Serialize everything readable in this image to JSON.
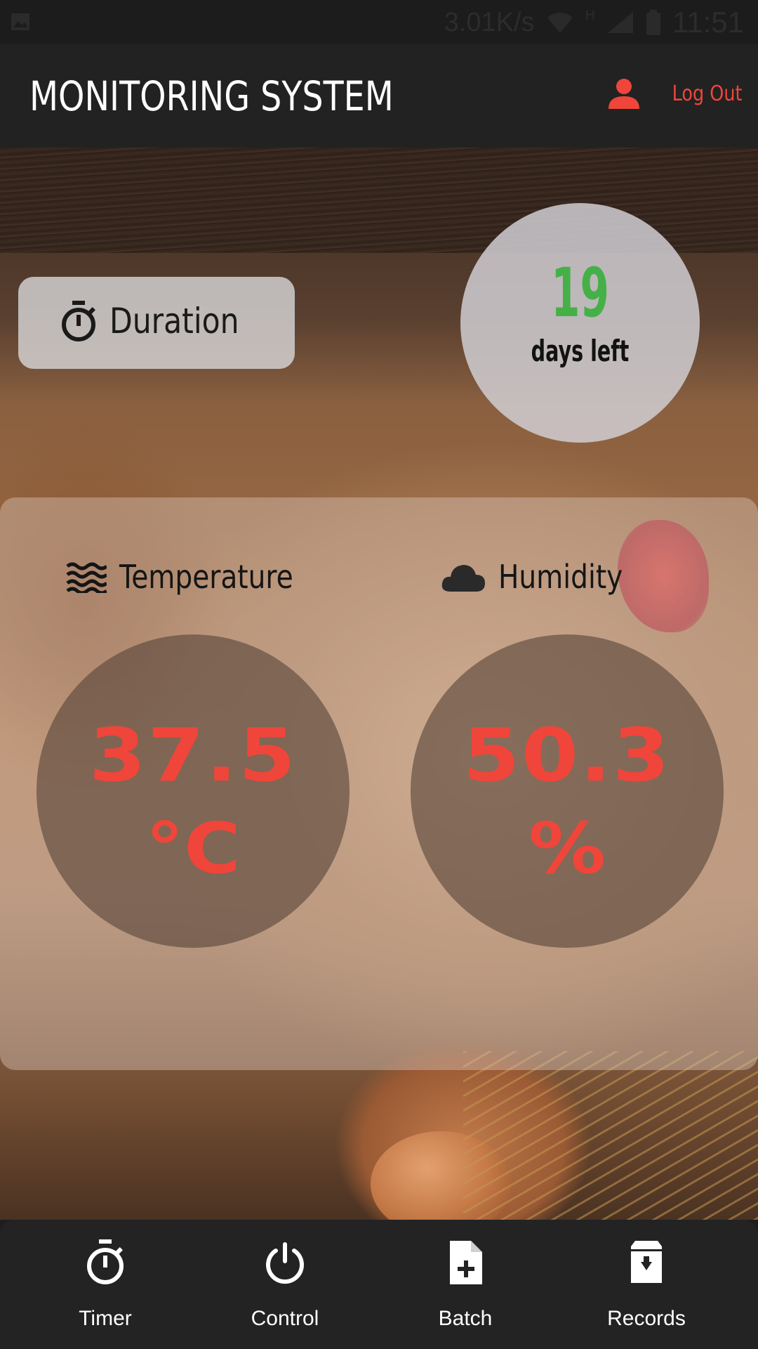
{
  "status_bar": {
    "network_speed": "3.01K/s",
    "signal_type": "H",
    "time": "11:51",
    "icons": [
      "image-icon",
      "wifi-icon",
      "signal-icon",
      "battery-icon"
    ]
  },
  "app_bar": {
    "title": "MONITORING SYSTEM",
    "logout_label": "Log Out",
    "logout_icon": "person-icon"
  },
  "duration": {
    "label": "Duration",
    "icon": "stopwatch-icon"
  },
  "countdown": {
    "value": "19",
    "label": "days left",
    "value_color": "#45b048"
  },
  "readings": {
    "temperature": {
      "label": "Temperature",
      "icon": "waves-icon",
      "value": "37.5",
      "unit": "°C"
    },
    "humidity": {
      "label": "Humidity",
      "icon": "cloud-icon",
      "value": "50.3",
      "unit": "%"
    },
    "value_color": "#f0453a"
  },
  "bottom_nav": {
    "items": [
      {
        "label": "Timer",
        "icon": "stopwatch-icon"
      },
      {
        "label": "Control",
        "icon": "power-icon"
      },
      {
        "label": "Batch",
        "icon": "file-add-icon"
      },
      {
        "label": "Records",
        "icon": "archive-icon"
      }
    ]
  },
  "colors": {
    "accent": "#f0453a",
    "app_bar": "#222222",
    "nav_bar": "#232323"
  }
}
